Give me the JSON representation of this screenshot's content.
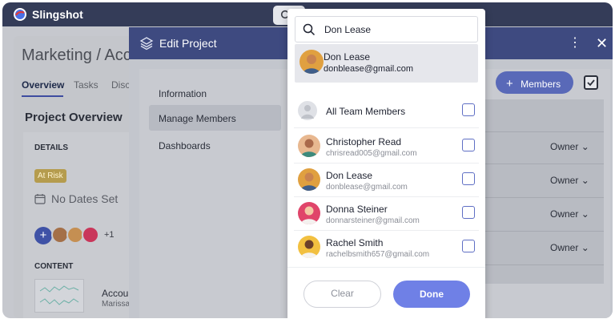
{
  "app": {
    "brand": "Slingshot"
  },
  "background": {
    "page_title": "Marketing / Acc",
    "tabs": [
      "Overview",
      "Tasks",
      "Disc"
    ],
    "section_title": "Project Overview",
    "details_label": "DETAILS",
    "status_badge": "At Risk",
    "dates": "No Dates Set",
    "members_more": "+1",
    "content_label": "CONTENT",
    "content_item_title": "Accou",
    "content_item_owner": "Marissa"
  },
  "modal": {
    "title": "Edit Project",
    "menu": [
      "Information",
      "Manage Members",
      "Dashboards"
    ],
    "active_menu": "Manage Members",
    "members_button": "Members",
    "role_labels": [
      "Owner",
      "Owner",
      "Owner",
      "Owner"
    ]
  },
  "dropdown": {
    "search_value": "Don Lease",
    "suggestion": {
      "name": "Don Lease",
      "email": "donblease@gmail.com"
    },
    "all_team_label": "All Team Members",
    "members": [
      {
        "name": "Christopher Read",
        "email": "chrisread005@gmail.com",
        "avatar_color": "#d8a06a"
      },
      {
        "name": "Don Lease",
        "email": "donblease@gmail.com",
        "avatar_color": "#e0a040"
      },
      {
        "name": "Donna Steiner",
        "email": "donnarsteiner@gmail.com",
        "avatar_color": "#e0456a"
      },
      {
        "name": "Rachel Smith",
        "email": "rachelbsmith657@gmail.com",
        "avatar_color": "#f2c040"
      }
    ],
    "clear_label": "Clear",
    "done_label": "Done"
  },
  "colors": {
    "header": "#343c58",
    "accent": "#6f80e6",
    "badge": "#e8b84a"
  }
}
